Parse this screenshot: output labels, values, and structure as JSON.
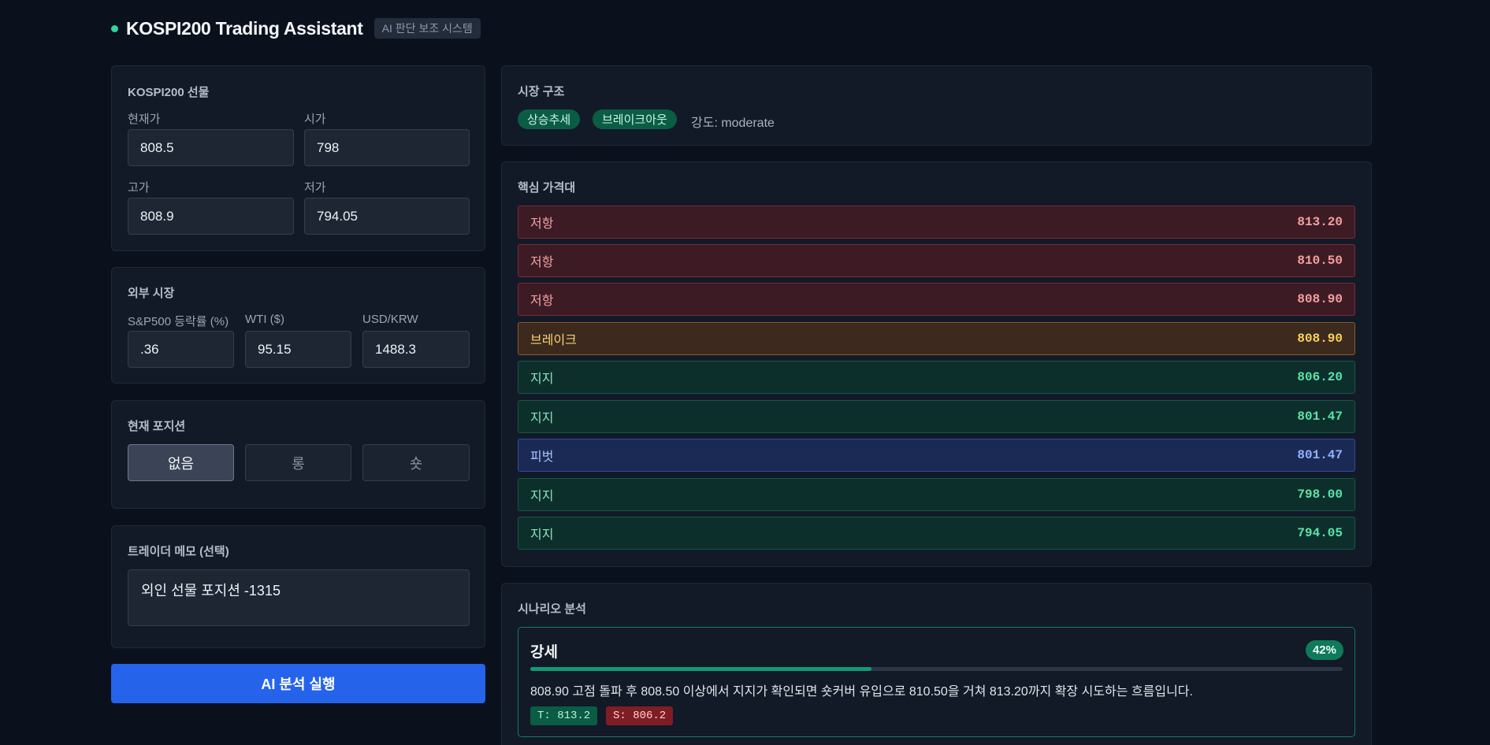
{
  "header": {
    "title": "KOSPI200 Trading Assistant",
    "badge": "AI 판단 보조 시스템"
  },
  "futures": {
    "title": "KOSPI200 선물",
    "current_label": "현재가",
    "current_value": "808.5",
    "open_label": "시가",
    "open_value": "798",
    "high_label": "고가",
    "high_value": "808.9",
    "low_label": "저가",
    "low_value": "794.05"
  },
  "external": {
    "title": "외부 시장",
    "sp500_label": "S&P500 등락률 (%)",
    "sp500_value": ".36",
    "wti_label": "WTI ($)",
    "wti_value": "95.15",
    "usdkrw_label": "USD/KRW",
    "usdkrw_value": "1488.3"
  },
  "position": {
    "title": "현재 포지션",
    "options": [
      "없음",
      "롱",
      "숏"
    ],
    "selected": "없음"
  },
  "memo": {
    "title": "트레이더 메모 (선택)",
    "value": "외인 선물 포지션 -1315"
  },
  "run_button": "AI 분석 실행",
  "market_structure": {
    "title": "시장 구조",
    "tags": [
      "상승추세",
      "브레이크아웃"
    ],
    "strength": "강도: moderate"
  },
  "key_levels": {
    "title": "핵심 가격대",
    "levels": [
      {
        "type": "resistance",
        "label": "저항",
        "value": "813.20"
      },
      {
        "type": "resistance",
        "label": "저항",
        "value": "810.50"
      },
      {
        "type": "resistance",
        "label": "저항",
        "value": "808.90"
      },
      {
        "type": "breakout",
        "label": "브레이크",
        "value": "808.90"
      },
      {
        "type": "support",
        "label": "지지",
        "value": "806.20"
      },
      {
        "type": "support",
        "label": "지지",
        "value": "801.47"
      },
      {
        "type": "pivot",
        "label": "피벗",
        "value": "801.47"
      },
      {
        "type": "support",
        "label": "지지",
        "value": "798.00"
      },
      {
        "type": "support",
        "label": "지지",
        "value": "794.05"
      }
    ]
  },
  "scenarios": {
    "title": "시나리오 분석",
    "items": [
      {
        "name": "강세",
        "probability_label": "42%",
        "probability": 0.42,
        "description": "808.90 고점 돌파 후 808.50 이상에서 지지가 확인되면 숏커버 유입으로 810.50을 거쳐 813.20까지 확장 시도하는 흐름입니다.",
        "target": "T: 813.2",
        "stop": "S: 806.2"
      }
    ]
  },
  "colors": {
    "accent": "#2563eb",
    "status_dot": "#34d399",
    "resistance": "#f4a0a0",
    "breakout": "#f9d25e",
    "support": "#5ee3a8",
    "pivot": "#8fb3ff"
  }
}
